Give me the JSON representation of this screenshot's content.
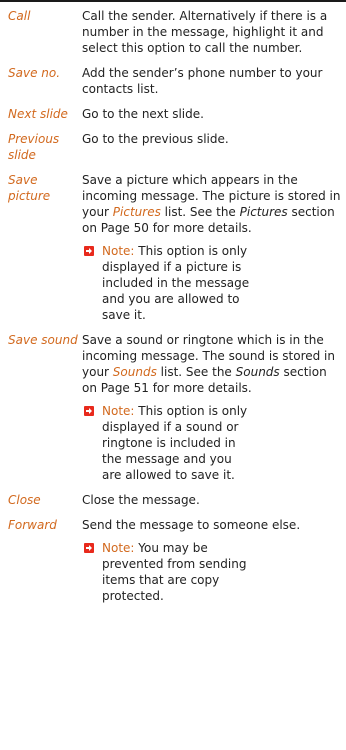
{
  "entries": [
    {
      "term": "Call",
      "desc": "Call the sender. Alternatively if there is a number in the message, highlight it and select this option to call the number."
    },
    {
      "term": "Save no.",
      "desc": "Add the sender’s phone number to your contacts list."
    },
    {
      "term": "Next slide",
      "desc": "Go to the next slide."
    },
    {
      "term": "Previous slide",
      "desc": "Go to the previous slide."
    },
    {
      "term": "Save picture",
      "desc_a": "Save a picture which appears in the incoming message. The picture is stored in your ",
      "list_name": "Pictures",
      "desc_b": " list. See the ",
      "section_name": "Pictures",
      "desc_c": " section on Page 50 for more details.",
      "note_label": "Note:",
      "note_text": " This option is only displayed if a picture is included in the message and you are allowed to save it."
    },
    {
      "term": "Save sound",
      "desc_a": "Save a sound or ringtone which is in the incoming message. The sound is stored in your ",
      "list_name": "Sounds",
      "desc_b": " list. See the ",
      "section_name": "Sounds",
      "desc_c": " section on Page 51 for more details.",
      "note_label": "Note:",
      "note_text": " This option is only displayed if a sound or ringtone is included in the message and you are allowed to save it."
    },
    {
      "term": "Close",
      "desc": "Close the message."
    },
    {
      "term": "Forward",
      "desc": "Send the message to someone else.",
      "note_label": "Note:",
      "note_text": " You may be prevented from sending items that are copy protected."
    }
  ],
  "colors": {
    "accent": "#d2691e",
    "note_icon": "#e8291c",
    "text": "#222222",
    "rule": "#1a1a1a"
  },
  "icons": {
    "note": "arrow-right-box-icon"
  }
}
